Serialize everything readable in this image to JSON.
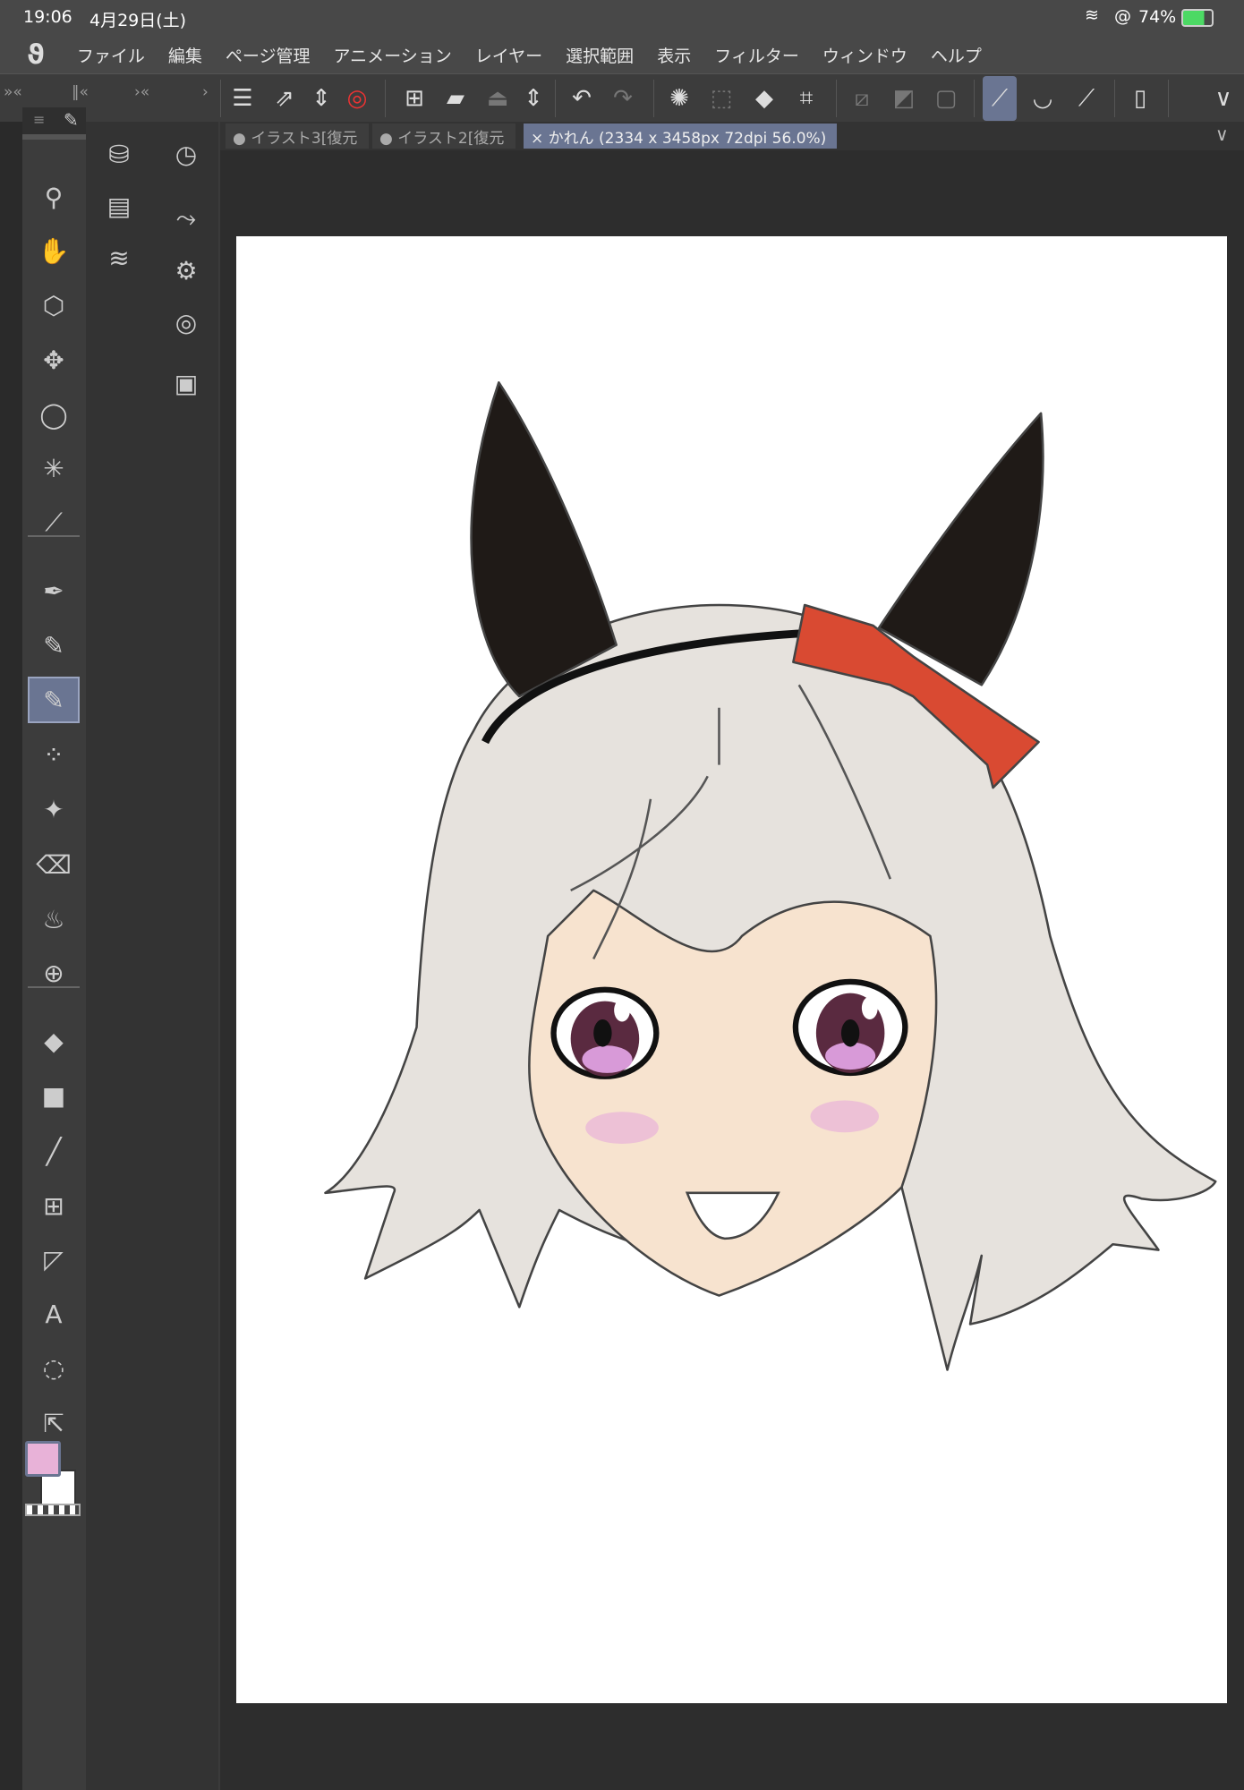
{
  "status": {
    "time": "19:06",
    "date": "4月29日(土)",
    "battery": "74%"
  },
  "menu": [
    "ファイル",
    "編集",
    "ページ管理",
    "アニメーション",
    "レイヤー",
    "選択範囲",
    "表示",
    "フィルター",
    "ウィンドウ",
    "ヘルプ"
  ],
  "tabs": [
    {
      "label": "● イラスト3[復元"
    },
    {
      "label": "● イラスト2[復元"
    },
    {
      "label": "× かれん (2334 x 3458px 72dpi 56.0%)"
    }
  ],
  "panel_nav": {
    "a": "»«",
    "b": "‖«",
    "c": "›«",
    "d": "›"
  },
  "colors": {
    "main": "#e8b2d8",
    "sub": "#ffffff",
    "accent": "#6a7592"
  },
  "tools": [
    "search-icon",
    "hand-icon",
    "object-select-icon",
    "move-icon",
    "lasso-icon",
    "magic-wand-icon",
    "eyedropper-icon",
    "pen-icon",
    "pencil-icon",
    "brush-icon",
    "airbrush-icon",
    "decoration-icon",
    "eraser-icon",
    "blend-icon",
    "mesh-transform-icon",
    "fill-icon",
    "gradient-icon",
    "figure-icon",
    "frame-icon",
    "ruler-icon",
    "text-icon",
    "balloon-icon",
    "correct-line-icon"
  ],
  "selected_tool": "brush-icon"
}
